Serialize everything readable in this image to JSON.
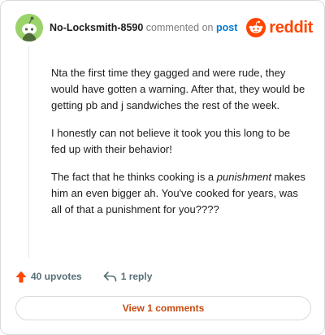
{
  "header": {
    "username": "No-Locksmith-8590",
    "commented_on": "commented on",
    "post_link": "post",
    "brand": "reddit"
  },
  "comment": {
    "p1": "Nta the first time they gagged and were rude, they would have gotten a warning. After that, they would be getting pb and j sandwiches the rest of the week.",
    "p2": "I honestly can not believe it took you this long to be fed up with their behavior!",
    "p3_before": "The fact that he thinks cooking is a ",
    "p3_emphasis": "punishment",
    "p3_after": " makes him an even bigger ah. You've cooked for years, was all of that a punishment for you????"
  },
  "actions": {
    "upvotes": "40 upvotes",
    "replies": "1 reply"
  },
  "footer": {
    "view_comments": "View 1 comments"
  },
  "colors": {
    "brand_orange": "#ff4500",
    "link_blue": "#0079d3",
    "avatar_green": "#9bd36b",
    "view_button_text": "#c64a0e"
  },
  "icons": {
    "avatar": "snoo-avatar-icon",
    "brand": "reddit-logo-icon",
    "upvote": "upvote-arrow-icon",
    "reply": "reply-arrow-icon"
  }
}
